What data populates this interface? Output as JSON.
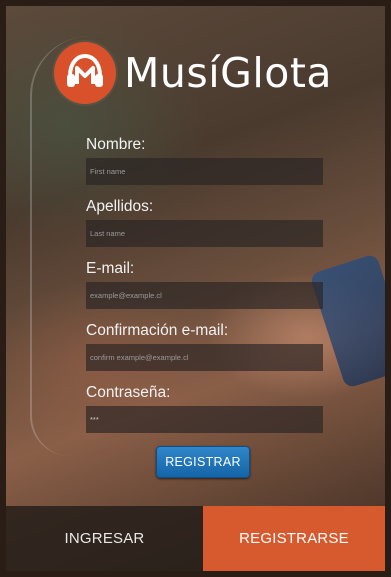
{
  "app": {
    "name": "MusíGlota",
    "logo_icon": "music-note-headphones-icon",
    "brand_color": "#d8512b"
  },
  "form": {
    "fields": [
      {
        "label": "Nombre:",
        "placeholder": "First name",
        "value": ""
      },
      {
        "label": "Apellidos:",
        "placeholder": "Last name",
        "value": ""
      },
      {
        "label": "E-mail:",
        "placeholder": "example@example.cl",
        "value": ""
      },
      {
        "label": "Confirmación e-mail:",
        "placeholder": "confirm example@example.cl",
        "value": ""
      },
      {
        "label": "Contraseña:",
        "placeholder": "",
        "value": "***"
      }
    ],
    "submit_label": "REGISTRAR",
    "submit_color": "#1f75bb"
  },
  "bottom_nav": {
    "tabs": [
      {
        "label": "INGRESAR",
        "active": false
      },
      {
        "label": "REGISTRARSE",
        "active": true,
        "color": "#d65a2e"
      }
    ]
  }
}
